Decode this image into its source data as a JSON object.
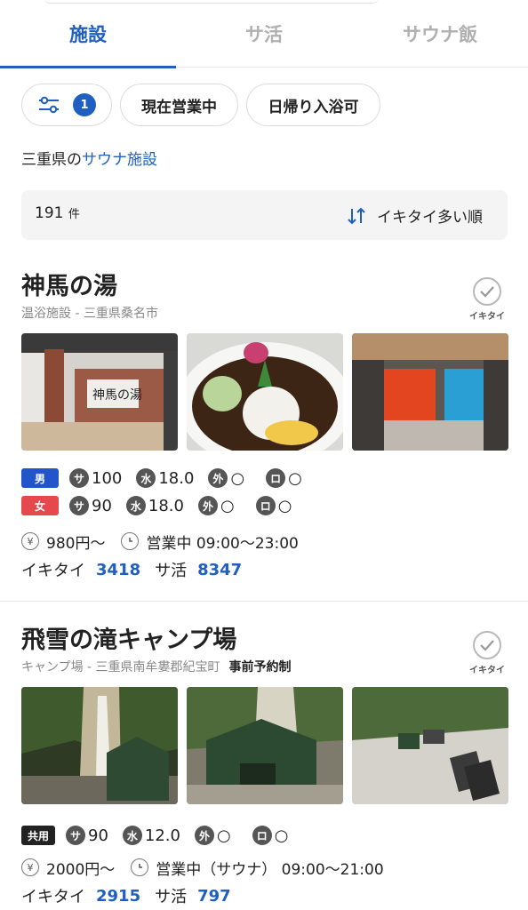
{
  "tabs": [
    {
      "label": "施設",
      "active": true
    },
    {
      "label": "サ活",
      "active": false
    },
    {
      "label": "サウナ飯",
      "active": false
    }
  ],
  "filters": {
    "count": "1",
    "chips": [
      "現在営業中",
      "日帰り入浴可"
    ]
  },
  "breadcrumb": {
    "prefix": "三重県の",
    "link": "サウナ施設"
  },
  "results": {
    "count": "191",
    "unit": "件",
    "sort_label": "イキタイ多い順"
  },
  "facilities": [
    {
      "name": "神馬の湯",
      "subtitle": "温浴施設 - 三重県桑名市",
      "ikitai_label": "イキタイ",
      "rows": [
        {
          "gender": "男",
          "sauna": "100",
          "water": "18.0",
          "outdoor": "○",
          "rest": "○"
        },
        {
          "gender": "女",
          "sauna": "90",
          "water": "18.0",
          "outdoor": "○",
          "rest": "○"
        }
      ],
      "price": "980円〜",
      "hours": "営業中 09:00〜23:00",
      "ikitai_count": "3418",
      "sakatsu_count": "8347"
    },
    {
      "name": "飛雪の滝キャンプ場",
      "subtitle": "キャンプ場 - 三重県南牟婁郡紀宝町",
      "badge": "事前予約制",
      "ikitai_label": "イキタイ",
      "rows": [
        {
          "gender": "共用",
          "sauna": "90",
          "water": "12.0",
          "outdoor": "○",
          "rest": "○"
        }
      ],
      "price": "2000円〜",
      "hours": "営業中（サウナ） 09:00〜21:00",
      "ikitai_count": "2915",
      "sakatsu_count": "797"
    }
  ],
  "labels": {
    "sauna": "サ",
    "water": "水",
    "outdoor": "外",
    "rest": "ロ",
    "ikitai": "イキタイ",
    "sakatsu": "サ活",
    "yen": "¥"
  },
  "colors": {
    "accent": "#1f5fbf",
    "male": "#2255c9",
    "female": "#e5484d"
  }
}
